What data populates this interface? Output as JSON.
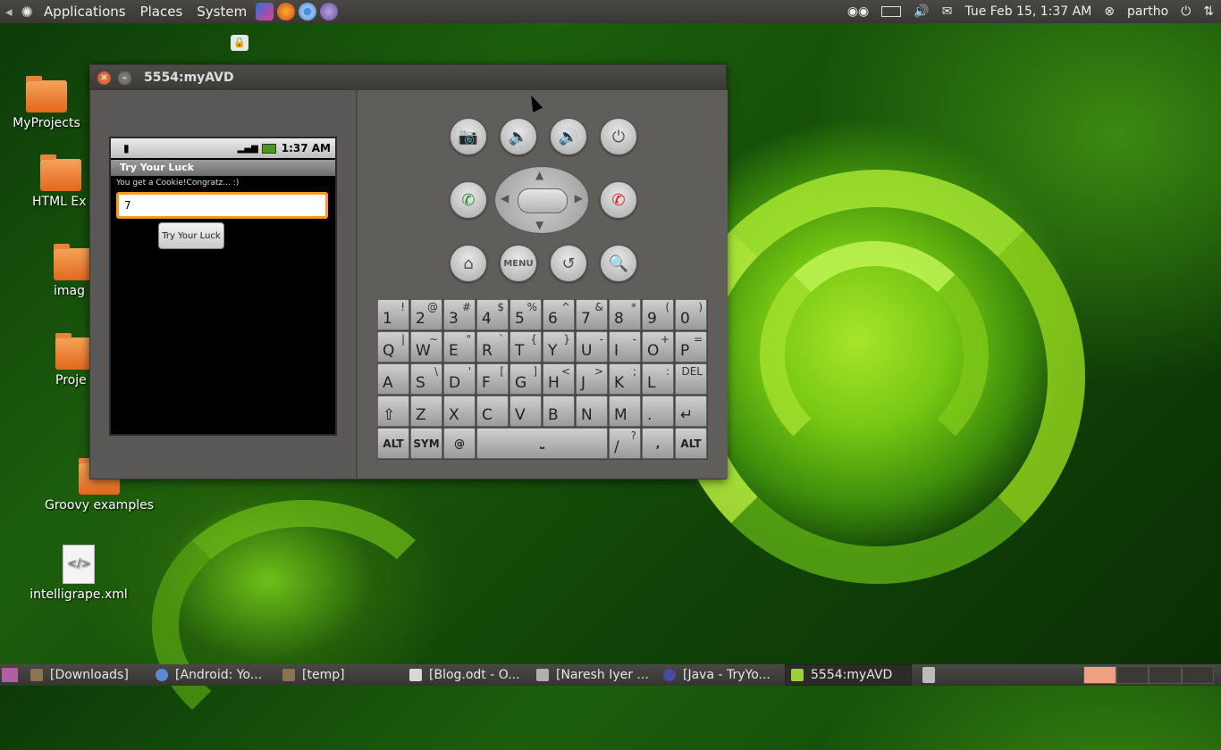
{
  "top_panel": {
    "menus": [
      "Applications",
      "Places",
      "System"
    ],
    "clock": "Tue Feb 15,  1:37 AM",
    "user": "partho"
  },
  "desktop": {
    "icons": [
      {
        "label": "MyProjects"
      },
      {
        "label": "HTML Ex"
      },
      {
        "label": "imag"
      },
      {
        "label": "Proje"
      },
      {
        "label": "Groovy examples"
      },
      {
        "label": "intelligrape.xml"
      }
    ]
  },
  "window": {
    "title": "5554:myAVD",
    "phone": {
      "status_time": "1:37 AM",
      "app_title": "Try Your Luck",
      "message": "You get a Cookie!Congratz... :)",
      "input_value": "7",
      "button_label": "Try Your Luck"
    },
    "controls": {
      "menu_label": "MENU"
    },
    "keyboard": {
      "rows": [
        [
          {
            "m": "1",
            "s": "!"
          },
          {
            "m": "2",
            "s": "@"
          },
          {
            "m": "3",
            "s": "#"
          },
          {
            "m": "4",
            "s": "$"
          },
          {
            "m": "5",
            "s": "%"
          },
          {
            "m": "6",
            "s": "^"
          },
          {
            "m": "7",
            "s": "&"
          },
          {
            "m": "8",
            "s": "*"
          },
          {
            "m": "9",
            "s": "("
          },
          {
            "m": "0",
            "s": ")"
          }
        ],
        [
          {
            "m": "Q",
            "s": "|"
          },
          {
            "m": "W",
            "s": "~"
          },
          {
            "m": "E",
            "s": "\""
          },
          {
            "m": "R",
            "s": "`"
          },
          {
            "m": "T",
            "s": "{"
          },
          {
            "m": "Y",
            "s": "}"
          },
          {
            "m": "U",
            "s": "-"
          },
          {
            "m": "I",
            "s": "-"
          },
          {
            "m": "O",
            "s": "+"
          },
          {
            "m": "P",
            "s": "="
          }
        ],
        [
          {
            "m": "A",
            "s": ""
          },
          {
            "m": "S",
            "s": "\\"
          },
          {
            "m": "D",
            "s": "'"
          },
          {
            "m": "F",
            "s": "["
          },
          {
            "m": "G",
            "s": "]"
          },
          {
            "m": "H",
            "s": "<"
          },
          {
            "m": "J",
            "s": ">"
          },
          {
            "m": "K",
            "s": ";"
          },
          {
            "m": "L",
            "s": ":"
          },
          {
            "m": "",
            "s": "DEL"
          }
        ],
        [
          {
            "m": "⇧",
            "s": ""
          },
          {
            "m": "Z",
            "s": ""
          },
          {
            "m": "X",
            "s": ""
          },
          {
            "m": "C",
            "s": ""
          },
          {
            "m": "V",
            "s": ""
          },
          {
            "m": "B",
            "s": ""
          },
          {
            "m": "N",
            "s": ""
          },
          {
            "m": "M",
            "s": ""
          },
          {
            "m": ".",
            "s": ""
          },
          {
            "m": "↵",
            "s": ""
          }
        ]
      ],
      "bottom": {
        "alt": "ALT",
        "sym": "SYM",
        "at": "@",
        "slash": "/",
        "slash_alt": "?",
        "comma": ","
      }
    }
  },
  "taskbar": {
    "tasks": [
      "[Downloads]",
      "[Android: Yo...",
      "[temp]",
      "[Blog.odt - O...",
      "[Naresh Iyer ...",
      "[Java - TryYo...",
      "5554:myAVD"
    ]
  }
}
